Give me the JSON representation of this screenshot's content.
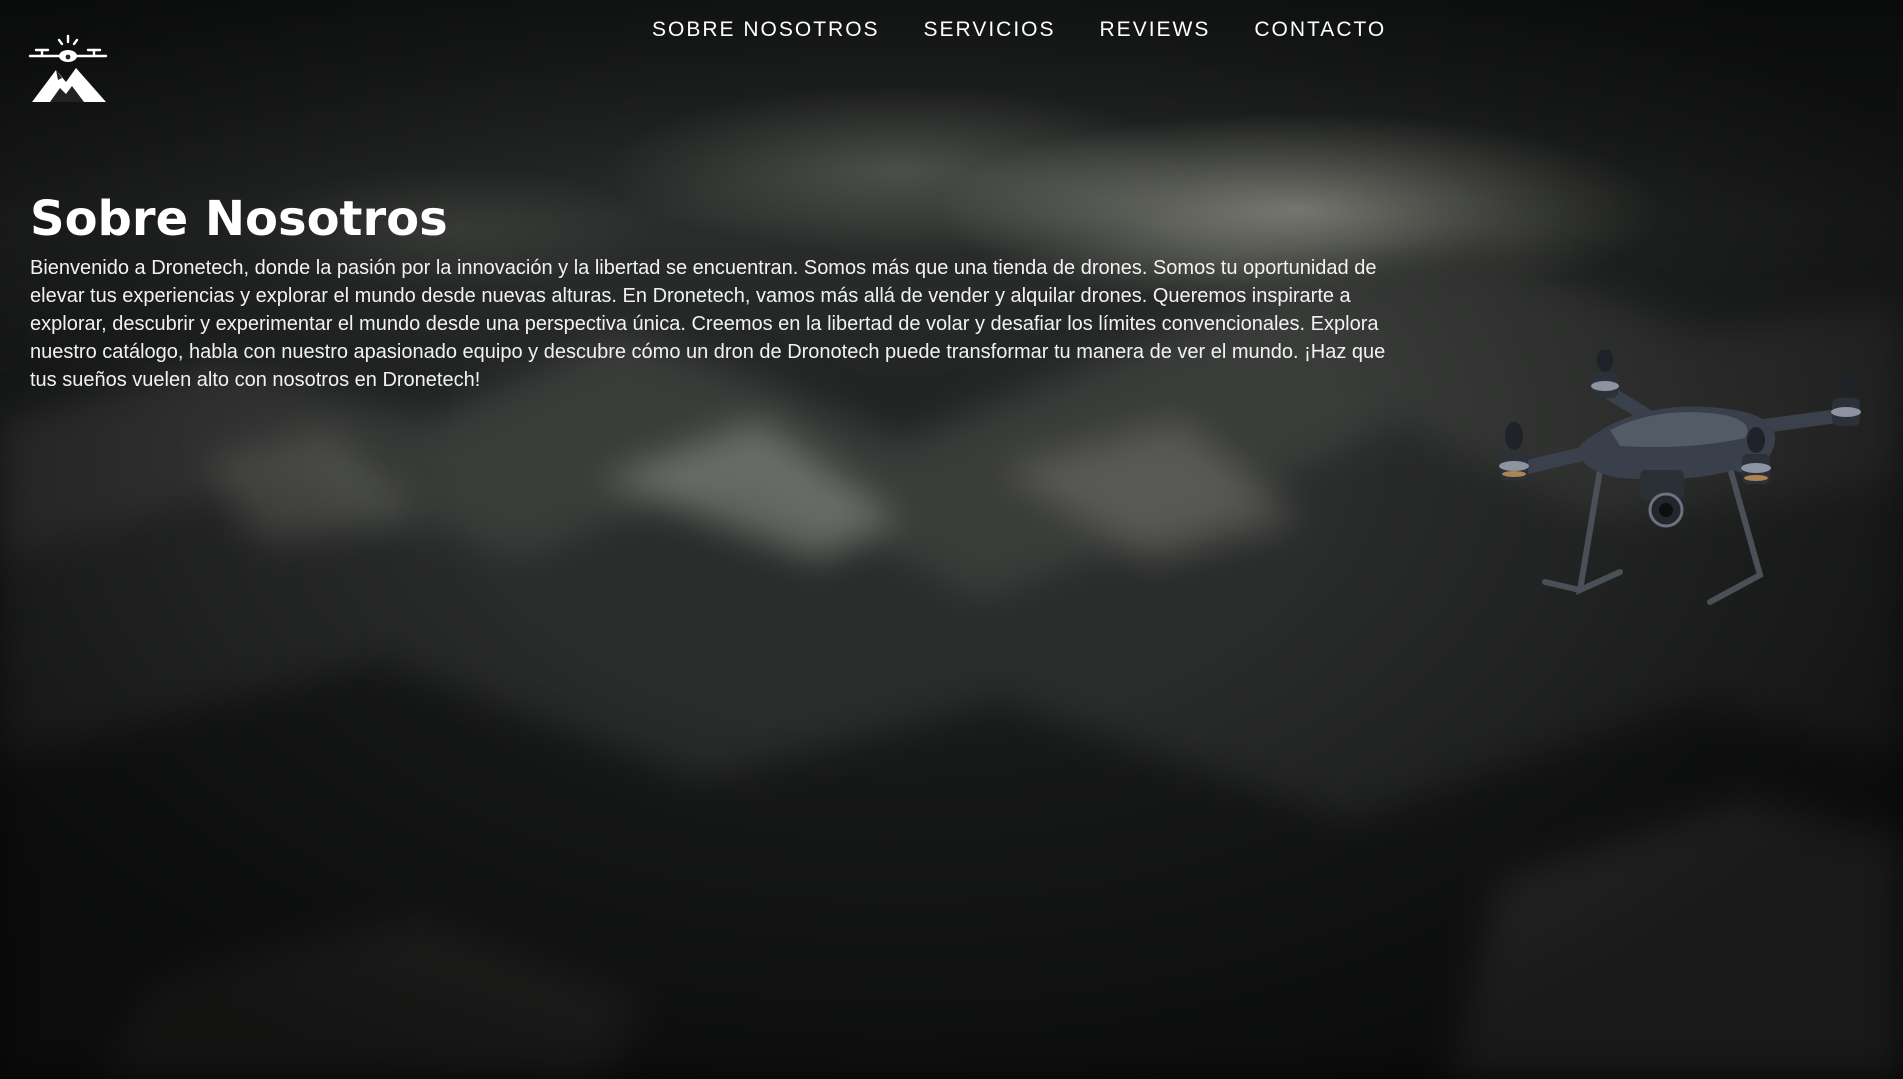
{
  "nav": {
    "items": [
      {
        "label": "SOBRE NOSOTROS"
      },
      {
        "label": "SERVICIOS"
      },
      {
        "label": "REVIEWS"
      },
      {
        "label": "CONTACTO"
      }
    ]
  },
  "about": {
    "title": "Sobre Nosotros",
    "body": "Bienvenido a Dronetech, donde la pasión por la innovación y la libertad se encuentran. Somos más que una tienda de drones. Somos tu oportunidad de elevar tus experiencias y explorar el mundo desde nuevas alturas. En Dronetech, vamos más allá de vender y alquilar drones. Queremos inspirarte a explorar, descubrir y experimentar el mundo desde una perspectiva única. Creemos en la libertad de volar y desafiar los límites convencionales. Explora nuestro catálogo, habla con nuestro apasionado equipo y descubre cómo un dron de Dronotech puede transformar tu manera de ver el mundo. ¡Haz que tus sueños vuelen alto con nosotros en Dronetech!"
  },
  "icons": {
    "logo": "drone-mountain-logo-icon",
    "hero_image": "quadcopter-drone-image"
  },
  "colors": {
    "text": "#ffffff",
    "background": "#151716"
  }
}
